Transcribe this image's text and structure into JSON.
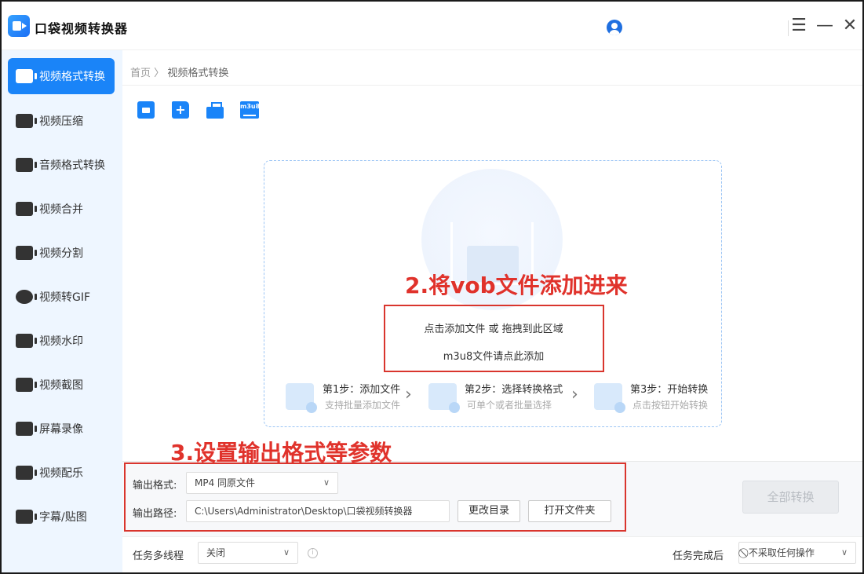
{
  "app": {
    "title": "口袋视频转换器"
  },
  "window": {
    "menu_icon": "hamburger-icon",
    "minimize_icon": "minimize-icon",
    "close_icon": "close-icon"
  },
  "sidebar": {
    "items": [
      {
        "label": "视频格式转换",
        "icon": "video-convert-icon",
        "active": true
      },
      {
        "label": "视频压缩",
        "icon": "compress-icon"
      },
      {
        "label": "音频格式转换",
        "icon": "audio-convert-icon"
      },
      {
        "label": "视频合并",
        "icon": "merge-icon"
      },
      {
        "label": "视频分割",
        "icon": "split-icon"
      },
      {
        "label": "视频转GIF",
        "icon": "gif-icon"
      },
      {
        "label": "视频水印",
        "icon": "watermark-icon"
      },
      {
        "label": "视频截图",
        "icon": "screenshot-icon"
      },
      {
        "label": "屏幕录像",
        "icon": "screen-record-icon"
      },
      {
        "label": "视频配乐",
        "icon": "music-icon"
      },
      {
        "label": "字幕/贴图",
        "icon": "subtitle-icon"
      }
    ]
  },
  "breadcrumb": {
    "home": "首页",
    "sep": "〉",
    "current": "视频格式转换"
  },
  "toolbar": {
    "m3u8_label": "m3u8"
  },
  "dropzone": {
    "line1": "点击添加文件 或 拖拽到此区域",
    "line2": "m3u8文件请点此添加",
    "steps": [
      {
        "title": "第1步：添加文件",
        "sub": "支持批量添加文件"
      },
      {
        "title": "第2步：选择转换格式",
        "sub": "可单个或者批量选择"
      },
      {
        "title": "第3步：开始转换",
        "sub": "点击按钮开始转换"
      }
    ]
  },
  "annotations": {
    "step2": "2.将vob文件添加进来",
    "step3": "3.设置输出格式等参数",
    "color": "#e0322b"
  },
  "output": {
    "format_label": "输出格式:",
    "format_value": "MP4  同原文件",
    "path_label": "输出路径:",
    "path_value": "C:\\Users\\Administrator\\Desktop\\口袋视频转换器",
    "change_dir": "更改目录",
    "open_folder": "打开文件夹",
    "convert_all": "全部转换"
  },
  "footer": {
    "multithread_label": "任务多线程",
    "multithread_value": "关闭",
    "after_done_label": "任务完成后",
    "after_done_value": "不采取任何操作"
  },
  "colors": {
    "accent": "#1a84f8",
    "sidebar_bg": "#eef6ff"
  }
}
